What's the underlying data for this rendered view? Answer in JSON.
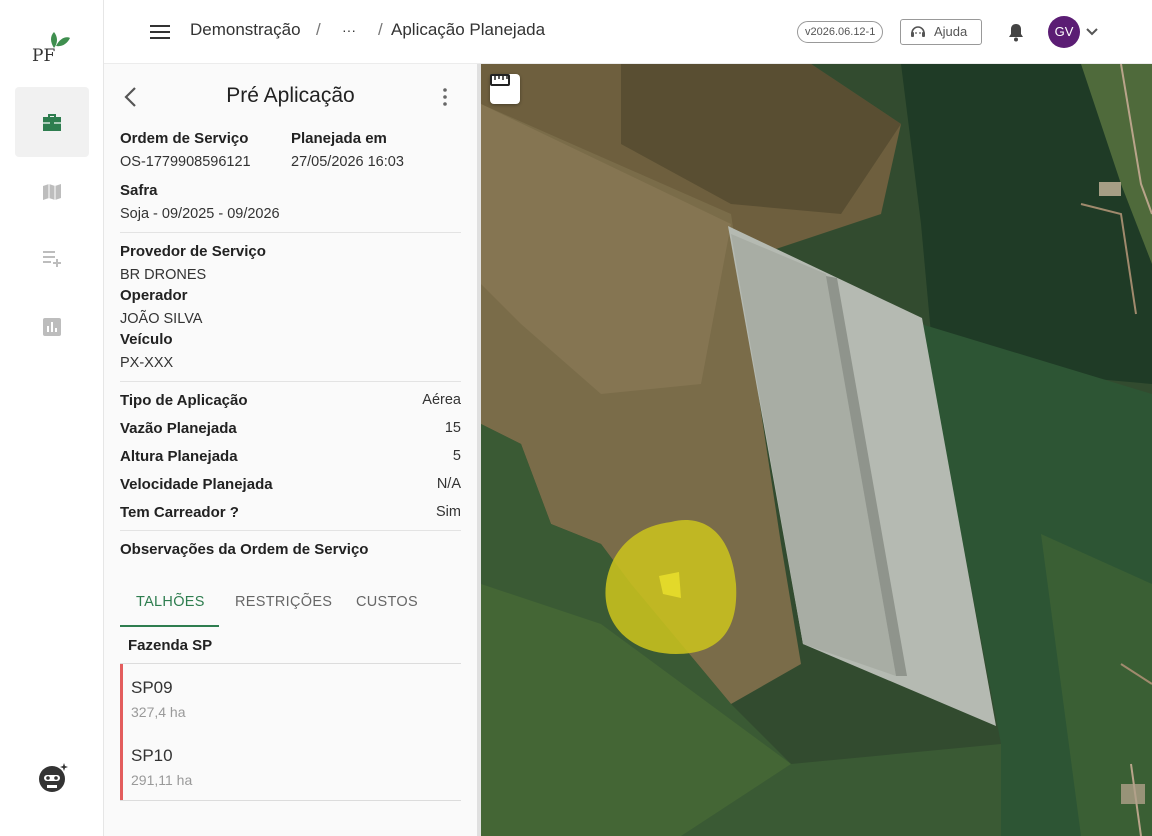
{
  "topbar": {
    "breadcrumb": [
      "Demonstração",
      "···",
      "Aplicação Planejada"
    ],
    "version": "v2026.06.12-1",
    "help_label": "Ajuda",
    "avatar_initials": "GV"
  },
  "rail": {
    "logo_text": "PF",
    "items": [
      "briefcase-icon",
      "map-icon",
      "playlist-add-icon",
      "bar-chart-icon"
    ],
    "active": "briefcase-icon"
  },
  "panel": {
    "title": "Pré Aplicação",
    "service_order_label": "Ordem de Serviço",
    "service_order_value": "OS-1779908596121",
    "planned_at_label": "Planejada em",
    "planned_at_value": "27/05/2026 16:03",
    "crop_label": "Safra",
    "crop_value": "Soja - 09/2025 - 09/2026",
    "provider_label": "Provedor de Serviço",
    "provider_value": "BR DRONES",
    "operator_label": "Operador",
    "operator_value": "JOÃO SILVA",
    "vehicle_label": "Veículo",
    "vehicle_value": "PX-XXX",
    "details": [
      {
        "label": "Tipo de Aplicação",
        "value": "Aérea"
      },
      {
        "label": "Vazão Planejada",
        "value": "15"
      },
      {
        "label": "Altura Planejada",
        "value": "5"
      },
      {
        "label": "Velocidade Planejada",
        "value": "N/A"
      },
      {
        "label": "Tem Carreador ?",
        "value": "Sim"
      }
    ],
    "notes_label": "Observações da Ordem de Serviço",
    "tabs": [
      "TALHÕES",
      "RESTRIÇÕES",
      "CUSTOS"
    ],
    "active_tab": "TALHÕES",
    "farm_name": "Fazenda SP",
    "plots": [
      {
        "name": "SP09",
        "area": "327,4 ha"
      },
      {
        "name": "SP10",
        "area": "291,11 ha"
      }
    ]
  },
  "colors": {
    "accent": "#2e7d4f",
    "avatar": "#5b1d74",
    "plot_bar": "#e35d5d",
    "highlight": "#c9c21e"
  }
}
